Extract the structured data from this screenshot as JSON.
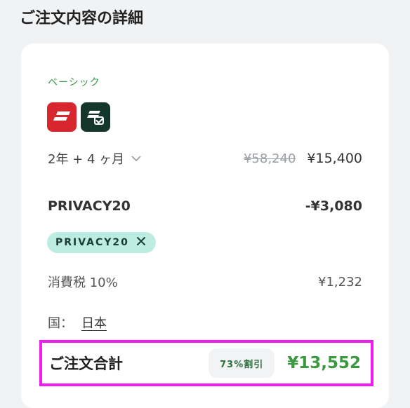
{
  "header": {
    "title": "ご注文内容の詳細"
  },
  "plan": {
    "label": "ベーシック",
    "icons": [
      "expressvpn-app-icon",
      "keys-app-icon"
    ]
  },
  "duration": {
    "value": "2年 + 4 ヶ月",
    "original_price": "¥58,240",
    "price": "¥15,400"
  },
  "coupon": {
    "code_label": "PRIVACY20",
    "discount": "-¥3,080",
    "chip_text": "PRIVACY20"
  },
  "tax": {
    "label": "消費税 10%",
    "amount": "¥1,232"
  },
  "country": {
    "label": "国：",
    "value": "日本"
  },
  "total": {
    "label": "ご注文合計",
    "discount_badge": "73%割引",
    "price": "¥13,552"
  },
  "colors": {
    "accent_green": "#3b9a3f",
    "chip_bg": "#bdece0",
    "highlight_border": "#f01cf0",
    "brand_red": "#d8262f",
    "brand_dark": "#14362b"
  }
}
